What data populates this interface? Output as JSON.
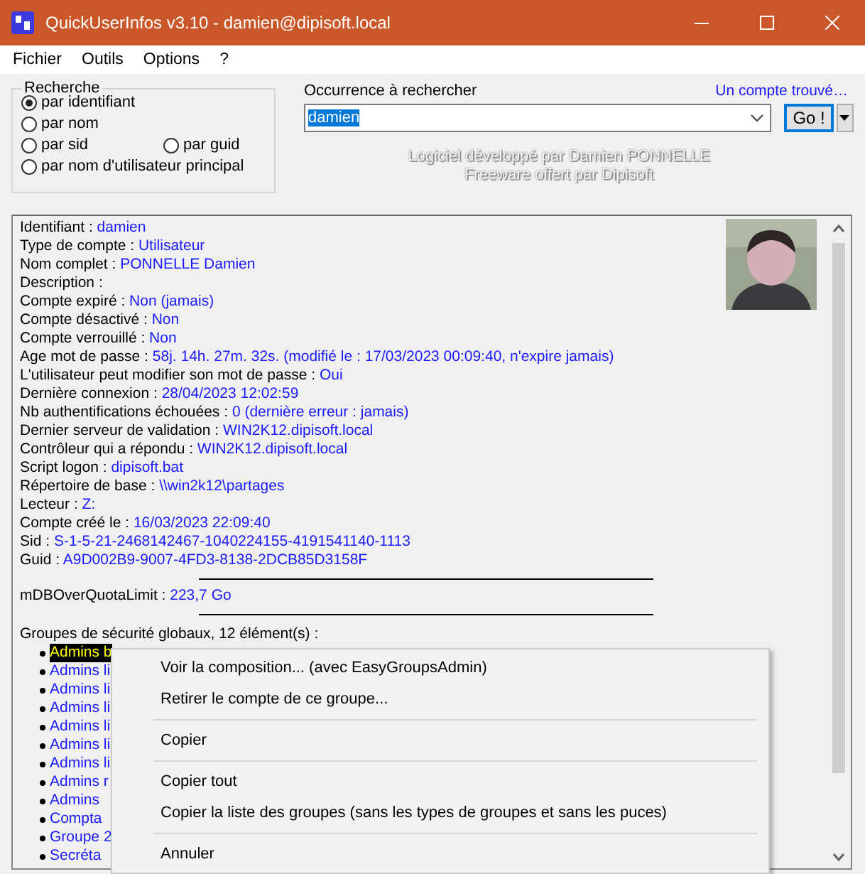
{
  "window": {
    "title": "QuickUserInfos v3.10 - damien@dipisoft.local"
  },
  "menu": [
    "Fichier",
    "Outils",
    "Options",
    "?"
  ],
  "search_mode": {
    "title": "Recherche",
    "options": [
      {
        "label": "par identifiant",
        "selected": true
      },
      {
        "label": "par nom",
        "selected": false
      },
      {
        "label": "par sid",
        "selected": false
      },
      {
        "label": "par guid",
        "selected": false
      },
      {
        "label": "par nom d'utilisateur principal",
        "selected": false
      }
    ]
  },
  "query": {
    "label": "Occurrence à rechercher",
    "value": "damien",
    "status_link": "Un compte trouvé…",
    "go_button": "Go !"
  },
  "credits": [
    "Logiciel développé par Damien PONNELLE",
    "Freeware offert par Dipisoft"
  ],
  "info": [
    {
      "label": "Identifiant :",
      "value": "damien"
    },
    {
      "label": "Type de compte :",
      "value": "Utilisateur"
    },
    {
      "label": "Nom complet :",
      "value": "PONNELLE Damien"
    },
    {
      "label": "Description :"
    },
    {
      "label": "Compte expiré :",
      "value": "Non (jamais)"
    },
    {
      "label": "Compte désactivé :",
      "value": "Non"
    },
    {
      "label": "Compte verrouillé :",
      "value": "Non"
    },
    {
      "label": "Age mot de passe :",
      "value": "58j. 14h. 27m. 32s. (modifié le : 17/03/2023 00:09:40, n'expire jamais)"
    },
    {
      "label": "L'utilisateur peut modifier son mot de passe :",
      "value": "Oui"
    },
    {
      "label": "Dernière connexion :",
      "value": "28/04/2023 12:02:59"
    },
    {
      "label": "Nb authentifications échouées :",
      "value": "0 (dernière erreur : jamais)"
    },
    {
      "label": "Dernier serveur de validation :",
      "value": "WIN2K12.dipisoft.local"
    },
    {
      "label": "Contrôleur qui a répondu :",
      "value": "WIN2K12.dipisoft.local"
    },
    {
      "label": "Script logon :",
      "value": "dipisoft.bat"
    },
    {
      "label": "Répertoire de base :",
      "value": "\\\\win2k12\\partages"
    },
    {
      "label": "Lecteur :",
      "value": "Z:"
    },
    {
      "label": "Compte créé le :",
      "value": "16/03/2023 22:09:40"
    },
    {
      "label": "Sid :",
      "value": "S-1-5-21-2468142467-1040224155-4191541140-1113"
    },
    {
      "label": "Guid :",
      "value": "A9D002B9-9007-4FD3-8138-2DCB85D3158F"
    }
  ],
  "quota": {
    "label": "mDBOverQuotaLimit :",
    "value": "223,7 Go"
  },
  "groups": {
    "heading": "Groupes de sécurité globaux, 12 élément(s) :",
    "items": [
      {
        "label": "Admins b",
        "selected": true
      },
      {
        "label": "Admins li",
        "selected": false
      },
      {
        "label": "Admins li",
        "selected": false
      },
      {
        "label": "Admins li",
        "selected": false
      },
      {
        "label": "Admins li",
        "selected": false
      },
      {
        "label": "Admins li",
        "selected": false
      },
      {
        "label": "Admins li",
        "selected": false
      },
      {
        "label": "Admins r",
        "selected": false
      },
      {
        "label": "Admins",
        "selected": false
      },
      {
        "label": "Compta",
        "selected": false
      },
      {
        "label": "Groupe 2",
        "selected": false
      },
      {
        "label": "Secréta",
        "selected": false
      }
    ]
  },
  "context_menu": [
    [
      "Voir la composition... (avec EasyGroupsAdmin)",
      "Retirer le compte de ce groupe..."
    ],
    [
      "Copier"
    ],
    [
      "Copier tout",
      "Copier la liste des groupes (sans les types de groupes et sans les puces)"
    ],
    [
      "Annuler"
    ]
  ]
}
